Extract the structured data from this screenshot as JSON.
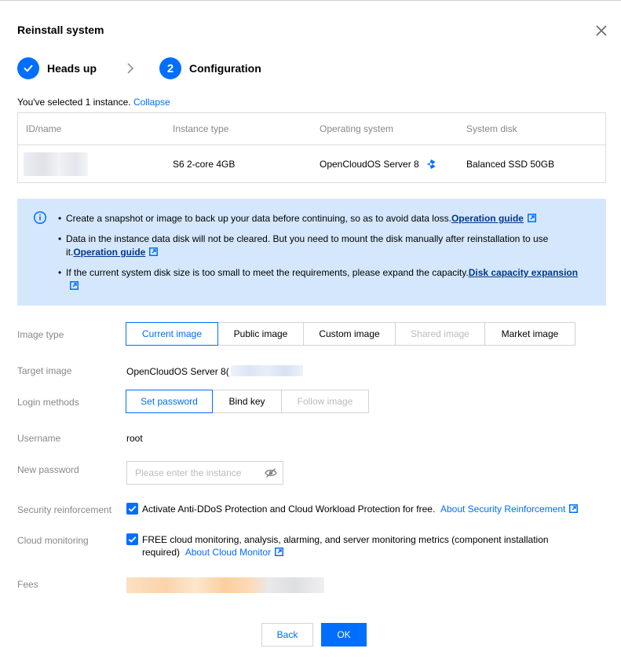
{
  "dialog": {
    "title": "Reinstall system"
  },
  "steps": [
    {
      "label": "Heads up",
      "state": "done"
    },
    {
      "number": "2",
      "label": "Configuration",
      "state": "active"
    }
  ],
  "selection": {
    "text": "You've selected 1 instance.",
    "collapse_label": "Collapse"
  },
  "instance_table": {
    "headers": [
      "ID/name",
      "Instance type",
      "Operating system",
      "System disk"
    ],
    "row": {
      "instance_type": "S6 2-core 4GB",
      "os": "OpenCloudOS Server 8",
      "disk": "Balanced SSD 50GB"
    }
  },
  "notice": {
    "item1_text": "Create a snapshot or image to back up your data before continuing, so as to avoid data loss.",
    "item1_link": "Operation guide",
    "item2_text": "Data in the instance data disk will not be cleared. But you need to mount the disk manually after reinstallation to use it.",
    "item2_link": "Operation guide",
    "item3_text": "If the current system disk size is too small to meet the requirements, please expand the capacity.",
    "item3_link": "Disk capacity expansion"
  },
  "form": {
    "image_type": {
      "label": "Image type",
      "options": [
        "Current image",
        "Public image",
        "Custom image",
        "Shared image",
        "Market image"
      ],
      "selected": "Current image",
      "disabled": [
        "Shared image"
      ]
    },
    "target_image": {
      "label": "Target image",
      "value": "OpenCloudOS Server 8("
    },
    "login_methods": {
      "label": "Login methods",
      "options": [
        "Set password",
        "Bind key",
        "Follow image"
      ],
      "selected": "Set password",
      "disabled": [
        "Follow image"
      ]
    },
    "username": {
      "label": "Username",
      "value": "root"
    },
    "new_password": {
      "label": "New password",
      "placeholder": "Please enter the instance"
    },
    "security": {
      "label": "Security reinforcement",
      "checked": true,
      "text": "Activate Anti-DDoS Protection and Cloud Workload Protection for free.",
      "link": "About Security Reinforcement"
    },
    "monitoring": {
      "label": "Cloud monitoring",
      "checked": true,
      "text": "FREE cloud monitoring, analysis, alarming, and server monitoring metrics (component installation required)",
      "link": "About Cloud Monitor"
    },
    "fees": {
      "label": "Fees"
    }
  },
  "footer": {
    "back_label": "Back",
    "ok_label": "OK"
  },
  "colors": {
    "accent": "#006eff",
    "notice_bg": "#d5e7fd",
    "link_dark": "#00388a",
    "muted": "#888888"
  },
  "icons": [
    "close-icon",
    "check-icon",
    "chevron-right-icon",
    "os-logo-icon",
    "info-icon",
    "external-link-icon",
    "eye-off-icon",
    "checkbox-check-icon"
  ]
}
